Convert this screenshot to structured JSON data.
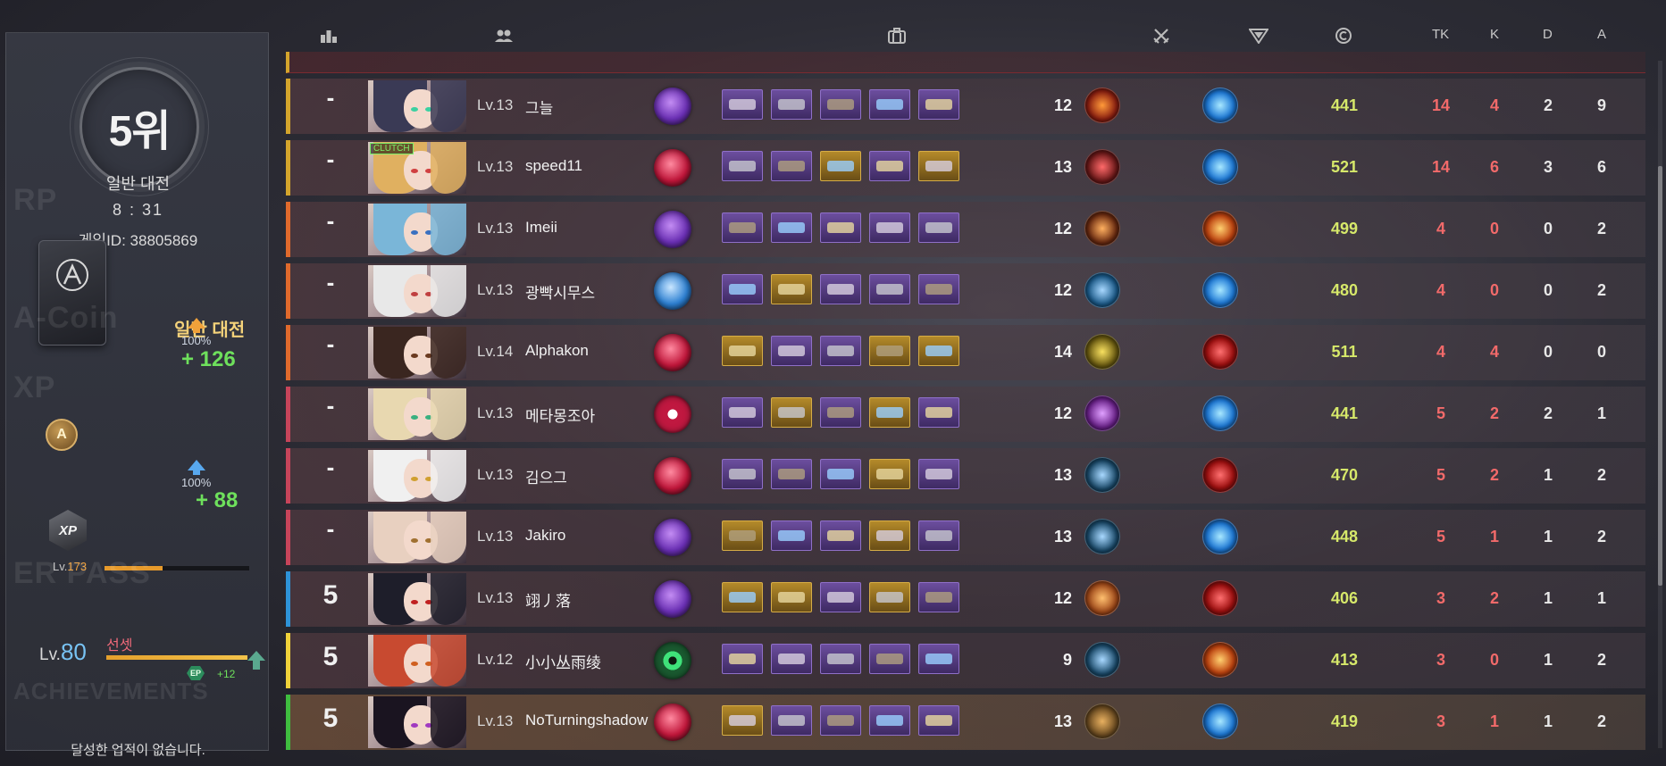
{
  "summary": {
    "rank": "5위",
    "mode": "일반 대전",
    "time": "8 : 31",
    "game_id_label": "게임ID:",
    "game_id": "38805869",
    "rp_section": "RP",
    "rp_mode_label": "일반 대전",
    "acoin_section": "A-Coin",
    "acoin_percent": "100%",
    "acoin_gain": "+ 126",
    "xp_section": "XP",
    "xp_icon_text": "XP",
    "xp_percent": "100%",
    "xp_gain": "+ 88",
    "xp_level_prefix": "Lv.",
    "xp_level": "173",
    "xp_progress": 0.4,
    "pass_section": "ER PASS",
    "pass_level_prefix": "Lv.",
    "pass_level": "80",
    "pass_name": "선셋",
    "ep_label": "EP",
    "ep_gain": "+12",
    "achievements_section": "ACHIEVEMENTS",
    "achievements_empty": "달성한 업적이 없습니다."
  },
  "header": {
    "tk": "TK",
    "k": "K",
    "d": "D",
    "a": "A"
  },
  "colors": {
    "stripe_gold": "#d4a52c",
    "stripe_orange": "#e06a2c",
    "stripe_red": "#c7445a",
    "stripe_blue": "#2e93d8",
    "stripe_yellow": "#f0d23a",
    "stripe_green": "#3fbd3f",
    "item_purple": "#6c4e9e",
    "item_gold": "#b48a2a",
    "credit": "#d6e86a",
    "kill_red": "#f26a6a"
  },
  "rows": [
    {
      "team_rank": "-",
      "stripe": "gold",
      "level": "Lv.13",
      "name": "그늘",
      "trait": "purple-smoke",
      "items": [
        "purple",
        "purple",
        "purple",
        "purple",
        "purple"
      ],
      "weapon_level": "12",
      "credits": "441",
      "tk": "14",
      "k": "4",
      "d": "2",
      "a": "9",
      "mine": false,
      "clutch": ""
    },
    {
      "team_rank": "-",
      "stripe": "gold",
      "level": "Lv.13",
      "name": "speed11",
      "trait": "red-blood",
      "items": [
        "purple",
        "purple",
        "gold",
        "purple",
        "gold"
      ],
      "weapon_level": "13",
      "credits": "521",
      "tk": "14",
      "k": "6",
      "d": "3",
      "a": "6",
      "mine": false,
      "clutch": "CLUTCH"
    },
    {
      "team_rank": "-",
      "stripe": "orange",
      "level": "Lv.13",
      "name": "Imeii",
      "trait": "purple-smoke",
      "items": [
        "purple",
        "purple",
        "purple",
        "purple",
        "purple"
      ],
      "weapon_level": "12",
      "credits": "499",
      "tk": "4",
      "k": "0",
      "d": "0",
      "a": "2",
      "mine": false,
      "clutch": ""
    },
    {
      "team_rank": "-",
      "stripe": "orange",
      "level": "Lv.13",
      "name": "광빡시무스",
      "trait": "blue-fist",
      "items": [
        "purple",
        "gold",
        "purple",
        "purple",
        "purple"
      ],
      "weapon_level": "12",
      "credits": "480",
      "tk": "4",
      "k": "0",
      "d": "0",
      "a": "2",
      "mine": false,
      "clutch": ""
    },
    {
      "team_rank": "-",
      "stripe": "orange",
      "level": "Lv.14",
      "name": "Alphakon",
      "trait": "red-blood",
      "items": [
        "gold",
        "purple",
        "purple",
        "gold",
        "gold"
      ],
      "weapon_level": "14",
      "credits": "511",
      "tk": "4",
      "k": "4",
      "d": "0",
      "a": "0",
      "mine": false,
      "clutch": ""
    },
    {
      "team_rank": "-",
      "stripe": "red",
      "level": "Lv.13",
      "name": "메타몽조아",
      "trait": "red-smile",
      "items": [
        "purple",
        "gold",
        "purple",
        "gold",
        "purple"
      ],
      "weapon_level": "12",
      "credits": "441",
      "tk": "5",
      "k": "2",
      "d": "2",
      "a": "1",
      "mine": false,
      "clutch": ""
    },
    {
      "team_rank": "-",
      "stripe": "red",
      "level": "Lv.13",
      "name": "김으그",
      "trait": "red-blood",
      "items": [
        "purple",
        "purple",
        "purple",
        "gold",
        "purple"
      ],
      "weapon_level": "13",
      "credits": "470",
      "tk": "5",
      "k": "2",
      "d": "1",
      "a": "2",
      "mine": false,
      "clutch": ""
    },
    {
      "team_rank": "-",
      "stripe": "red",
      "level": "Lv.13",
      "name": "Jakiro",
      "trait": "purple-smoke",
      "items": [
        "gold",
        "purple",
        "purple",
        "gold",
        "purple"
      ],
      "weapon_level": "13",
      "credits": "448",
      "tk": "5",
      "k": "1",
      "d": "1",
      "a": "2",
      "mine": false,
      "clutch": ""
    },
    {
      "team_rank": "5",
      "stripe": "blue",
      "level": "Lv.13",
      "name": "翊丿落",
      "trait": "purple-smoke",
      "items": [
        "gold",
        "gold",
        "purple",
        "gold",
        "purple"
      ],
      "weapon_level": "12",
      "credits": "406",
      "tk": "3",
      "k": "2",
      "d": "1",
      "a": "1",
      "mine": false,
      "clutch": ""
    },
    {
      "team_rank": "5",
      "stripe": "yellow",
      "level": "Lv.12",
      "name": "小小丛雨绫",
      "trait": "green-eye",
      "items": [
        "purple",
        "purple",
        "purple",
        "purple",
        "purple"
      ],
      "weapon_level": "9",
      "credits": "413",
      "tk": "3",
      "k": "0",
      "d": "1",
      "a": "2",
      "mine": false,
      "clutch": ""
    },
    {
      "team_rank": "5",
      "stripe": "green",
      "level": "Lv.13",
      "name": "NoTurningshadow",
      "trait": "red-blood",
      "items": [
        "gold",
        "purple",
        "purple",
        "purple",
        "purple"
      ],
      "weapon_level": "13",
      "credits": "419",
      "tk": "3",
      "k": "1",
      "d": "1",
      "a": "2",
      "mine": true,
      "clutch": ""
    }
  ]
}
